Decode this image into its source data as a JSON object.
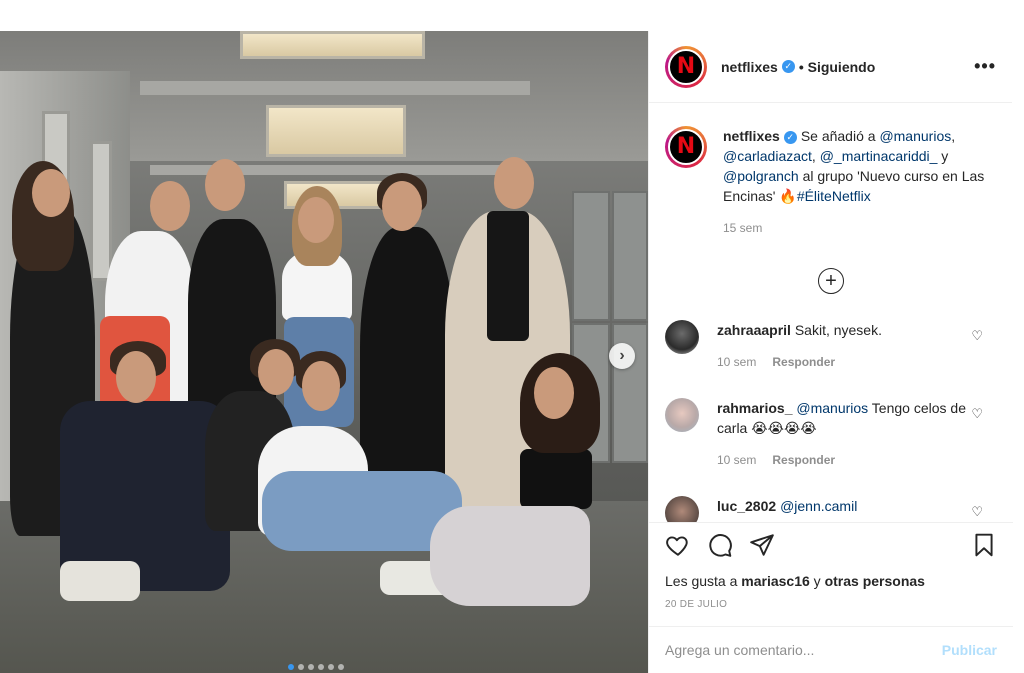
{
  "post": {
    "image_alt": "Elenco de Élite",
    "carousel": {
      "total": 6,
      "current": 1
    },
    "next_arrow": "›"
  },
  "header": {
    "username": "netflixes",
    "verified_mark": "✓",
    "follow_status": "• Siguiendo",
    "more": "•••",
    "avatar_letter": "N"
  },
  "caption": {
    "username": "netflixes",
    "text_1": "Se añadió a ",
    "mention_1": "@manurios",
    "sep_1": ",",
    "mention_2": "@carladiazact",
    "sep_2": ", ",
    "mention_3": "@_martinacariddi_",
    "sep_3": " y",
    "mention_4": "@polgranch",
    "text_2": " al grupo 'Nuevo curso en Las Encinas' ",
    "emoji": "🔥",
    "hashtag": "#ÉliteNetflix",
    "time": "15 sem"
  },
  "load_more": "+",
  "comments": [
    {
      "username": "zahraaapril",
      "text": "Sakit, nyesek.",
      "time": "10 sem",
      "reply": "Responder"
    },
    {
      "username": "rahmarios_",
      "mention": "@manurios",
      "text": " Tengo celos de carla ",
      "emojis": "😭😭😭😭",
      "time": "10 sem",
      "reply": "Responder"
    },
    {
      "username": "luc_2802",
      "mention": "@jenn.camil",
      "text": ""
    }
  ],
  "likes": {
    "prefix": "Les gusta a ",
    "user": "mariasc16",
    "middle": " y ",
    "others": "otras personas"
  },
  "date": "20 DE JULIO",
  "add_comment": {
    "placeholder": "Agrega un comentario...",
    "publish": "Publicar"
  },
  "colors": {
    "accent": "#3897f0",
    "netflix_red": "#e50914",
    "link": "#00376b",
    "muted": "#8e8e8e"
  }
}
